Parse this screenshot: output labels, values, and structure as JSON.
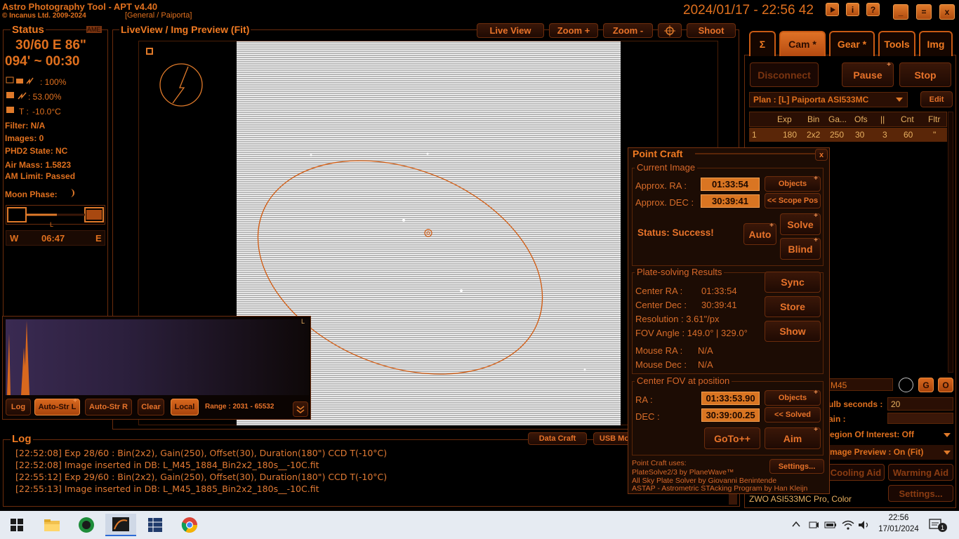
{
  "app": {
    "name": "Astro Photography Tool",
    "sep": "-",
    "version": "APT v4.40",
    "copyright": "© Incanus Ltd. 2009-2024",
    "profile": "[General / Paiporta]",
    "datetime": "2024/01/17 - 22:56 42"
  },
  "titlebar_icons": [
    "play-icon",
    "info-icon",
    "help-icon",
    "minimize-icon",
    "maximize-icon",
    "close-icon"
  ],
  "titlebar_labels": {
    "info": "i",
    "help": "?",
    "minimize": "_",
    "maximize": "=",
    "close": "x"
  },
  "status": {
    "title": "Status",
    "badge": "AME",
    "exposure": "30/60 E  86\"",
    "time": "094'  ~  00:30",
    "battery1": ": 100%",
    "battery2": ": 53.00%",
    "temp_label": "T :",
    "temp": "-10.0°C",
    "filter": "Filter: N/A",
    "images": "Images: 0",
    "phd2": "PHD2 State: NC",
    "airmass": "Air Mass: 1.5823",
    "amlimit": "AM Limit: Passed",
    "moon": "Moon Phase:",
    "meridian_w": "W",
    "meridian_time": "06:47",
    "meridian_e": "E",
    "meridian_mark": "L"
  },
  "liveview": {
    "title": "LiveView / Img Preview (Fit)",
    "buttons": [
      "Live View",
      "Zoom +",
      "Zoom -",
      "",
      "Shoot"
    ]
  },
  "histogram": {
    "corner": "L",
    "buttons": [
      "Log",
      "Auto-Str L",
      "Auto-Str R",
      "Clear",
      "Local"
    ],
    "range": "Range : 2031 - 65532"
  },
  "log": {
    "title": "Log",
    "lines": [
      "[22:52:08] Exp 28/60 : Bin(2x2), Gain(250), Offset(30), Duration(180\") CCD T(-10°C)",
      "[22:52:08] Image inserted in DB: L_M45_1884_Bin2x2_180s__-10C.fit",
      "[22:55:12] Exp 29/60 : Bin(2x2), Gain(250), Offset(30), Duration(180\") CCD T(-10°C)",
      "[22:55:13] Image inserted in DB: L_M45_1885_Bin2x2_180s__-10C.fit"
    ],
    "buttons": [
      "Data Craft",
      "USB Mo"
    ]
  },
  "tabs": [
    "Σ",
    "Cam *",
    "Gear *",
    "Tools",
    "Img"
  ],
  "cam": {
    "disconnect": "Disconnect",
    "pause": "Pause",
    "stop": "Stop",
    "plan": "Plan : [L] Paiporta ASI533MC",
    "edit": "Edit",
    "columns": [
      "",
      "Exp",
      "Bin",
      "Ga...",
      "Ofs",
      "||",
      "Cnt",
      "Fltr"
    ],
    "row": [
      "1",
      "180",
      "2x2",
      "250",
      "30",
      "3",
      "60",
      "\""
    ],
    "target": "M45",
    "bulb_label": "ulb seconds :",
    "bulb_value": "20",
    "gain_label": "ain :",
    "roi": "egion Of Interest: Off",
    "preview": "mage Preview : On (Fit)",
    "cooling": "Cooling Aid",
    "warming": "Warming Aid",
    "camera": "ZWO ASI533MC Pro, Color",
    "settings": "Settings...",
    "g": "G",
    "o": "O"
  },
  "pointcraft": {
    "title": "Point Craft",
    "close": "x",
    "current_image": "Current Image",
    "approx_ra_label": "Approx. RA :",
    "approx_ra": "01:33:54",
    "approx_dec_label": "Approx. DEC :",
    "approx_dec": "30:39:41",
    "objects": "Objects",
    "scope_pos": "<< Scope Pos",
    "status": "Status: Success!",
    "auto": "Auto",
    "solve": "Solve",
    "blind": "Blind",
    "results_title": "Plate-solving Results",
    "center_ra_label": "Center RA :",
    "center_ra": "01:33:54",
    "center_dec_label": "Center Dec :",
    "center_dec": "30:39:41",
    "resolution": "Resolution : 3.61\"/px",
    "fov_angle": "FOV Angle : 149.0° | 329.0°",
    "mouse_ra": "Mouse RA :",
    "mouse_ra_val": "N/A",
    "mouse_dec": "Mouse Dec :",
    "mouse_dec_val": "N/A",
    "sync": "Sync",
    "store": "Store",
    "show": "Show",
    "center_title": "Center FOV at position",
    "ra_label": "RA :",
    "ra": "01:33:53.90",
    "dec_label": "DEC :",
    "dec": "30:39:00.25",
    "objects2": "Objects",
    "solved": "<< Solved",
    "goto": "GoTo++",
    "aim": "Aim",
    "uses": "Point Craft uses:",
    "credit1": "PlateSolve2/3 by PlaneWave™",
    "credit2": "All Sky Plate Solver by Giovanni Benintende",
    "credit3": "ASTAP - Astrometric STAcking Program by Han Kleijn",
    "settings": "Settings..."
  },
  "taskbar": {
    "time": "22:56",
    "date": "17/01/2024",
    "icons": [
      "windows-start-icon",
      "file-explorer-icon",
      "media-app-icon",
      "apt-app-icon",
      "grid-app-icon",
      "chrome-icon"
    ],
    "tray": [
      "chevron-up-icon",
      "meet-icon",
      "battery-icon",
      "wifi-icon",
      "volume-icon"
    ],
    "notif": "1"
  },
  "colors": {
    "accent": "#f07a22",
    "field": "#d97522",
    "background": "#000000",
    "taskbar": "#e6ebf2"
  }
}
